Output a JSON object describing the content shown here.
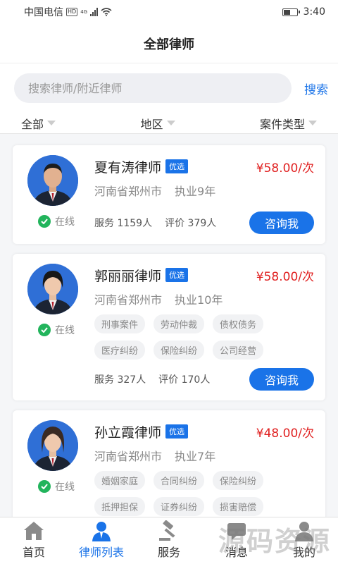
{
  "status_bar": {
    "carrier": "中国电信",
    "hd": "HD",
    "network": "4G",
    "time": "3:40",
    "battery_level": 0.5
  },
  "header": {
    "title": "全部律师"
  },
  "search": {
    "placeholder": "搜索律师/附近律师",
    "button": "搜索"
  },
  "filters": [
    "全部",
    "地区",
    "案件类型"
  ],
  "lawyers": [
    {
      "name": "夏有涛律师",
      "badge": "优选",
      "price": "¥58.00/次",
      "region": "河南省郑州市",
      "experience": "执业9年",
      "tags": [],
      "service": "服务 1159人",
      "rating": "评价 379人",
      "status": "在线",
      "consult": "咨询我"
    },
    {
      "name": "郭丽丽律师",
      "badge": "优选",
      "price": "¥58.00/次",
      "region": "河南省郑州市",
      "experience": "执业10年",
      "tags": [
        "刑事案件",
        "劳动仲裁",
        "债权债务",
        "医疗纠纷",
        "保险纠纷",
        "公司经营"
      ],
      "service": "服务 327人",
      "rating": "评价 170人",
      "status": "在线",
      "consult": "咨询我"
    },
    {
      "name": "孙立霞律师",
      "badge": "优选",
      "price": "¥48.00/次",
      "region": "河南省郑州市",
      "experience": "执业7年",
      "tags": [
        "婚姻家庭",
        "合同纠纷",
        "保险纠纷",
        "抵押担保",
        "证券纠纷",
        "损害赔偿"
      ],
      "status": "在线"
    }
  ],
  "tabbar": [
    {
      "label": "首页",
      "icon": "home-icon"
    },
    {
      "label": "律师列表",
      "icon": "lawyer-icon",
      "active": true
    },
    {
      "label": "服务",
      "icon": "gavel-icon"
    },
    {
      "label": "消息",
      "icon": "message-icon"
    },
    {
      "label": "我的",
      "icon": "profile-icon"
    }
  ],
  "watermark": "源码资源",
  "colors": {
    "accent": "#1a73e8",
    "price": "#e02020",
    "online": "#22b45c"
  }
}
